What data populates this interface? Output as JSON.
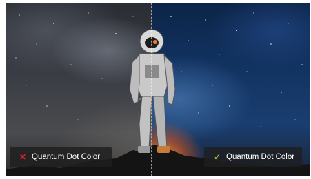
{
  "comparison": {
    "left": {
      "status_icon": "cross-icon",
      "status_color": "#e02626",
      "label": "Quantum Dot Color"
    },
    "right": {
      "status_icon": "check-icon",
      "status_color": "#8ed12a",
      "label": "Quantum Dot Color"
    }
  }
}
